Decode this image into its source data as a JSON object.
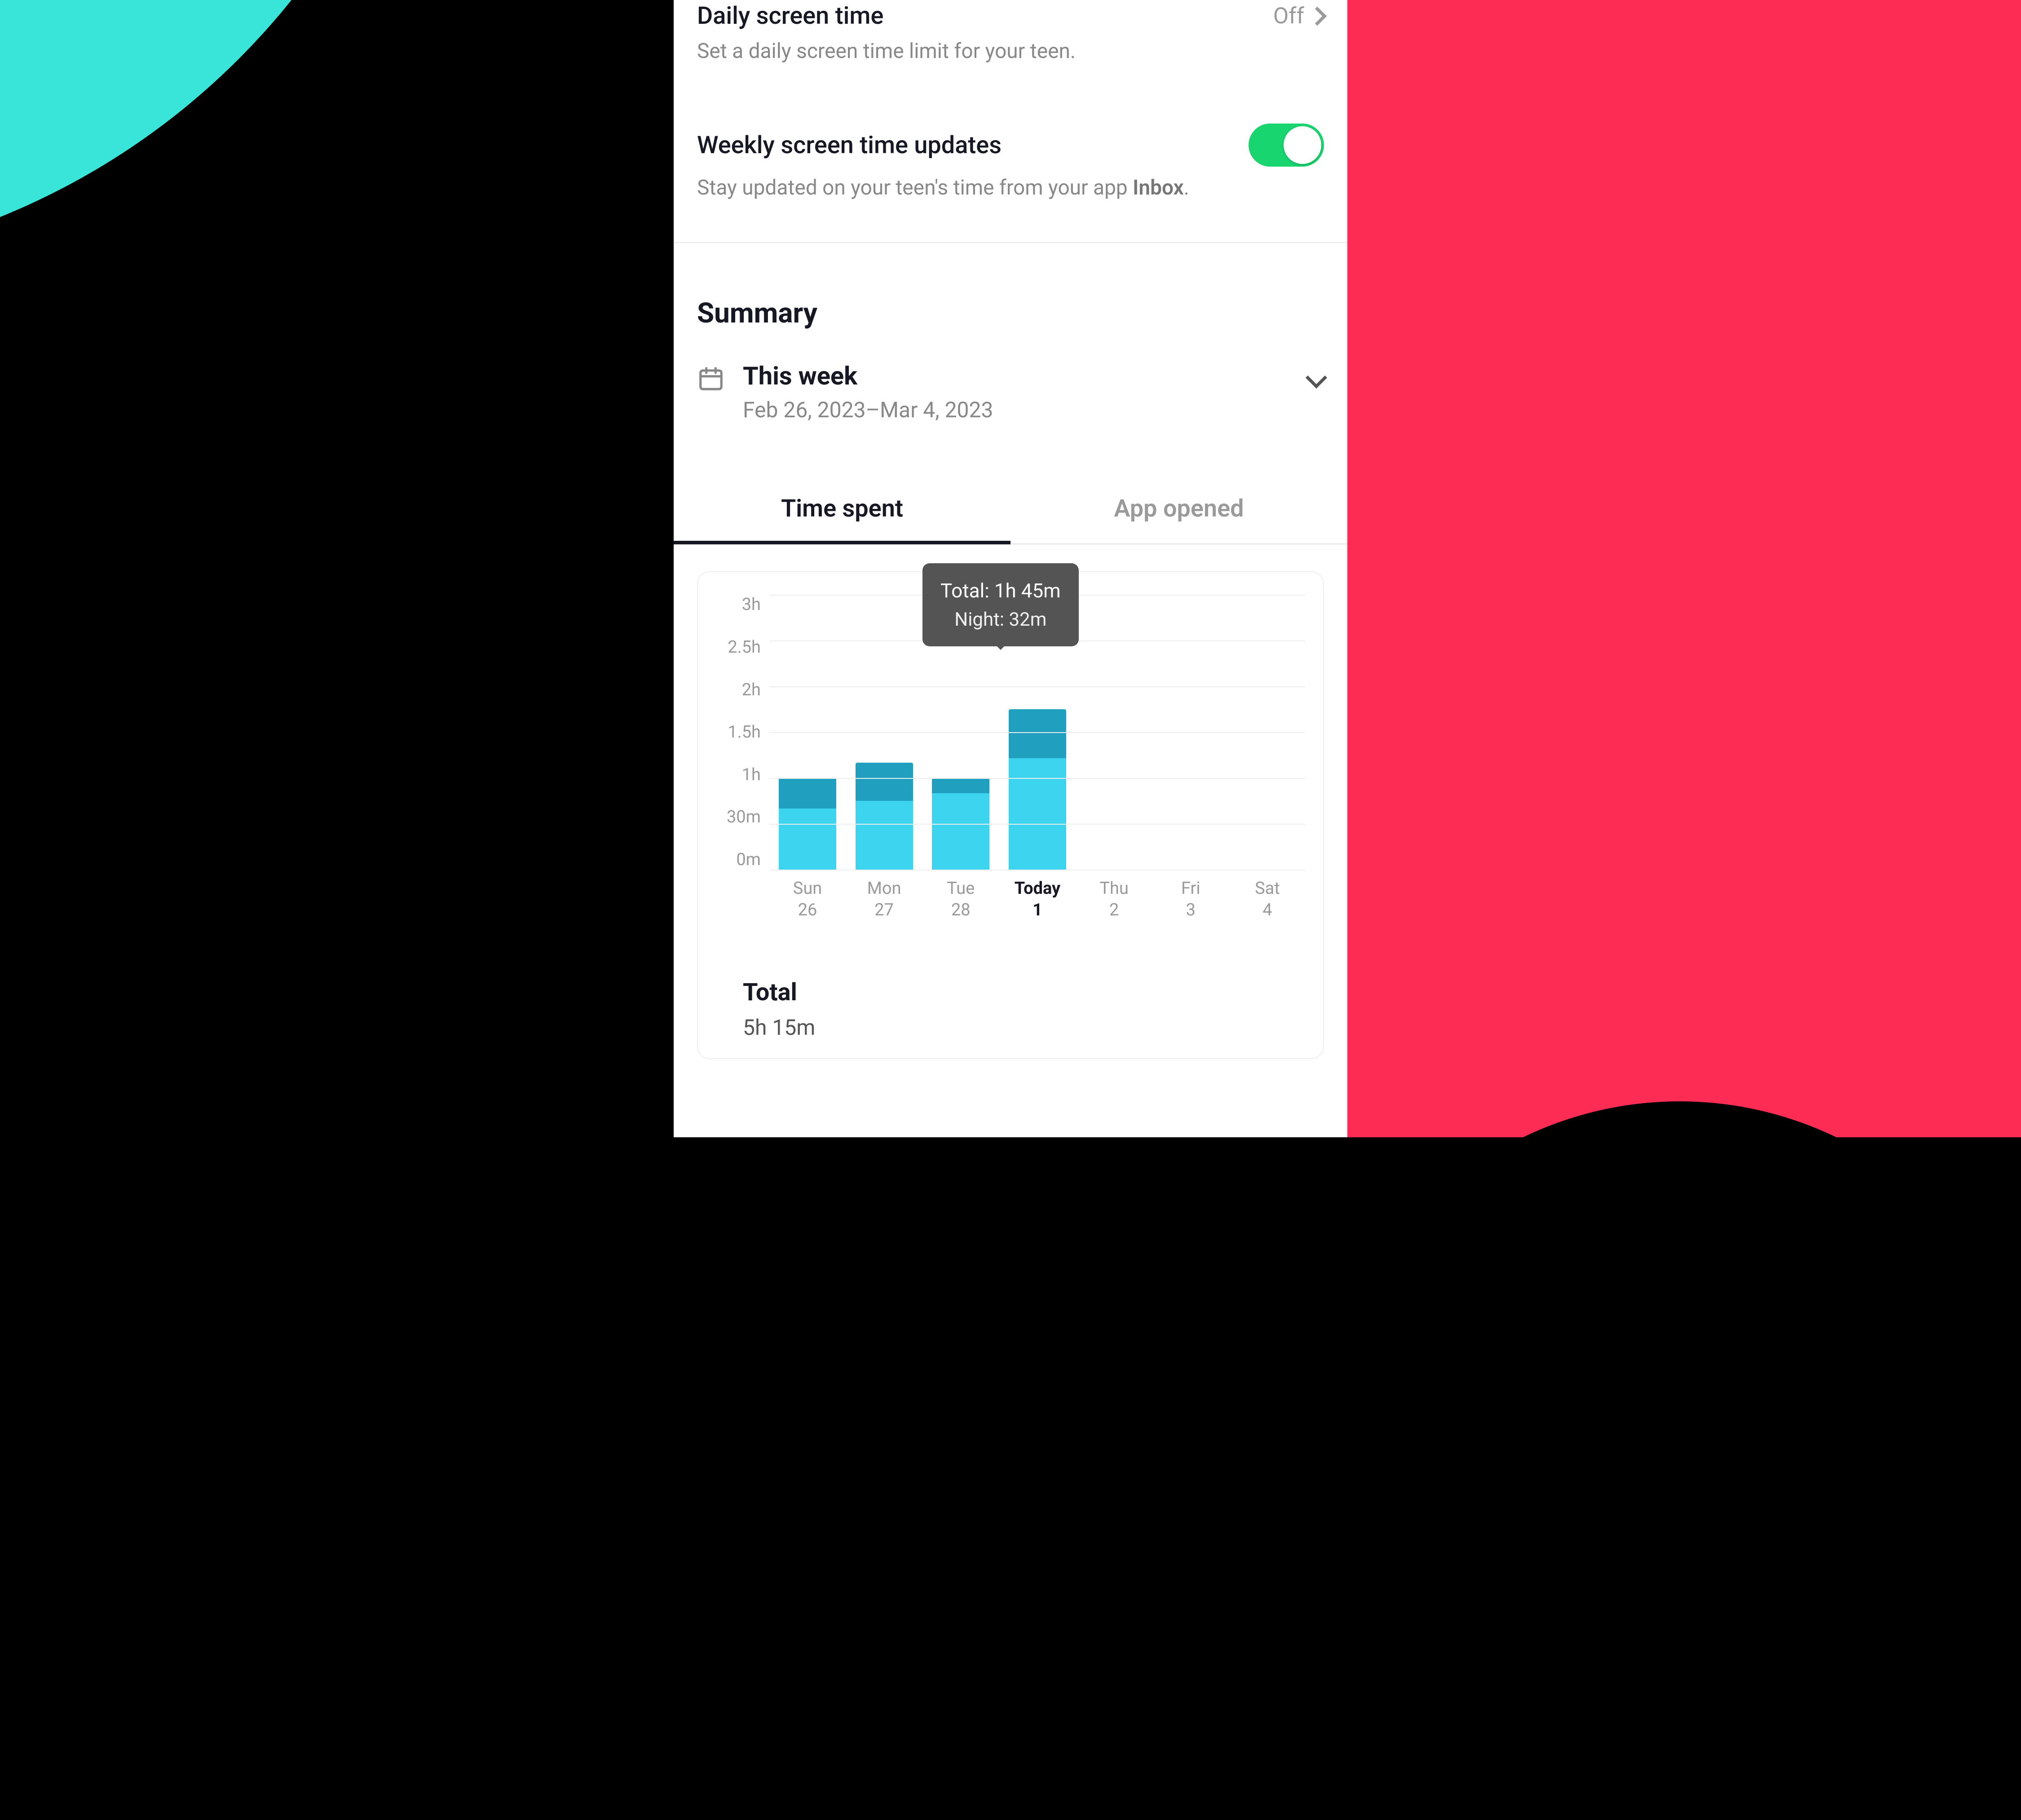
{
  "settings": {
    "daily": {
      "title": "Daily screen time",
      "status": "Off",
      "subtitle": "Set a daily screen time limit for your teen."
    },
    "weekly": {
      "title": "Weekly screen time updates",
      "subtitle_pre": "Stay updated on your teen's time from your app ",
      "subtitle_bold": "Inbox",
      "subtitle_post": "."
    }
  },
  "summary": {
    "title": "Summary",
    "week_label": "This week",
    "week_range": "Feb 26, 2023–Mar 4, 2023"
  },
  "tabs": {
    "time_spent": "Time spent",
    "app_opened": "App opened"
  },
  "chart_data": {
    "type": "bar",
    "ylabel": "",
    "xlabel": "",
    "ylim": [
      0,
      3
    ],
    "y_ticks": [
      "3h",
      "2.5h",
      "2h",
      "1.5h",
      "1h",
      "30m",
      "0m"
    ],
    "categories": [
      {
        "day": "Sun",
        "date": "26",
        "today": false
      },
      {
        "day": "Mon",
        "date": "27",
        "today": false
      },
      {
        "day": "Tue",
        "date": "28",
        "today": false
      },
      {
        "day": "Today",
        "date": "1",
        "today": true
      },
      {
        "day": "Thu",
        "date": "2",
        "today": false
      },
      {
        "day": "Fri",
        "date": "3",
        "today": false
      },
      {
        "day": "Sat",
        "date": "4",
        "today": false
      }
    ],
    "series": [
      {
        "name": "day_minutes",
        "values": [
          40,
          45,
          50,
          73,
          0,
          0,
          0
        ]
      },
      {
        "name": "night_minutes",
        "values": [
          20,
          25,
          10,
          32,
          0,
          0,
          0
        ]
      }
    ],
    "tooltip": {
      "index": 3,
      "line1": "Total: 1h 45m",
      "line2": "Night: 32m"
    }
  },
  "totals": {
    "label": "Total",
    "value": "5h 15m"
  }
}
